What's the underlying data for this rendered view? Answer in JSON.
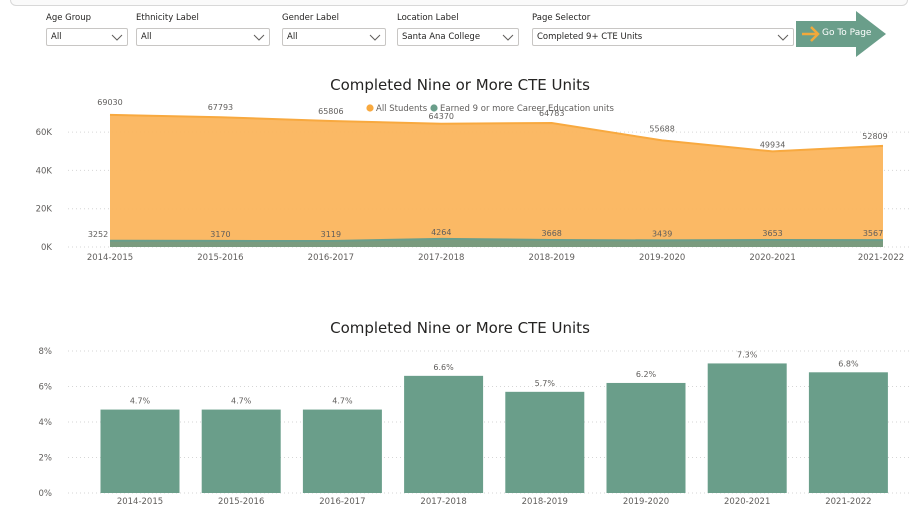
{
  "filters": [
    {
      "label": "Age Group",
      "value": "All"
    },
    {
      "label": "Ethnicity Label",
      "value": "All"
    },
    {
      "label": "Gender Label",
      "value": "All"
    },
    {
      "label": "Location Label",
      "value": "Santa Ana College"
    },
    {
      "label": "Page Selector",
      "value": "Completed 9+ CTE Units"
    }
  ],
  "go_button": {
    "label": "Go To Page",
    "color": "#6a9e8a",
    "arrow_color": "#f2a93b"
  },
  "colors": {
    "all_students": "#f8a93f",
    "all_students_area": "#fbb55d",
    "earned": "#6a9e8a"
  },
  "chart_data": [
    {
      "type": "area",
      "title": "Completed Nine or More CTE Units",
      "categories": [
        "2014-2015",
        "2015-2016",
        "2016-2017",
        "2017-2018",
        "2018-2019",
        "2019-2020",
        "2020-2021",
        "2021-2022"
      ],
      "series": [
        {
          "name": "All Students",
          "values": [
            69030,
            67793,
            65806,
            64370,
            64783,
            55688,
            49934,
            52809
          ]
        },
        {
          "name": "Earned 9 or more Career Education units",
          "values": [
            3252,
            3170,
            3119,
            4264,
            3668,
            3439,
            3653,
            3567
          ]
        }
      ],
      "yticks": [
        "0K",
        "20K",
        "40K",
        "60K"
      ],
      "ylim": [
        0,
        70000
      ],
      "legend": "top-center",
      "grid": true
    },
    {
      "type": "bar",
      "title": "Completed Nine or More CTE Units",
      "categories": [
        "2014-2015",
        "2015-2016",
        "2016-2017",
        "2017-2018",
        "2018-2019",
        "2019-2020",
        "2020-2021",
        "2021-2022"
      ],
      "values": [
        4.7,
        4.7,
        4.7,
        6.6,
        5.7,
        6.2,
        7.3,
        6.8
      ],
      "labels": [
        "4.7%",
        "4.7%",
        "4.7%",
        "6.6%",
        "5.7%",
        "6.2%",
        "7.3%",
        "6.8%"
      ],
      "yticks": [
        "0%",
        "2%",
        "4%",
        "6%",
        "8%"
      ],
      "ylim": [
        0,
        8
      ],
      "grid": true
    }
  ]
}
